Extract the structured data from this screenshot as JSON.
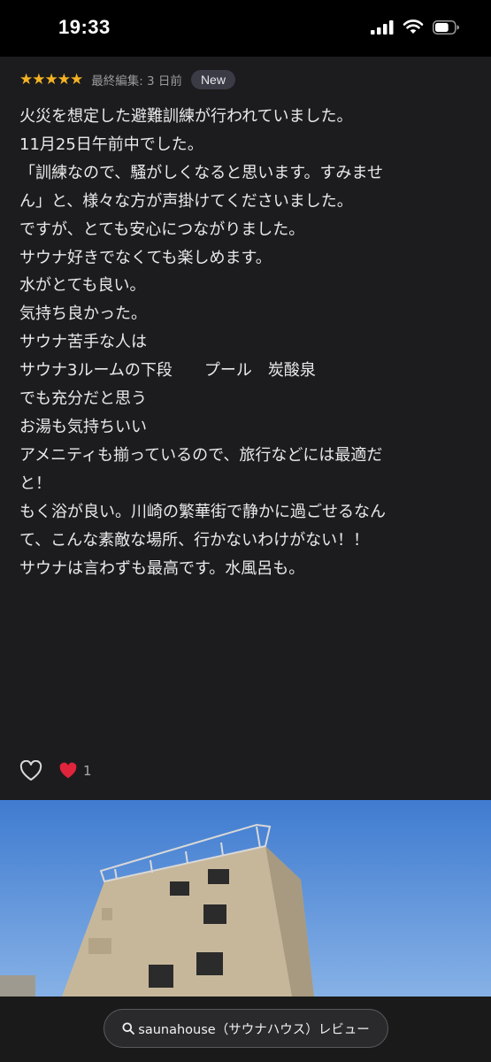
{
  "status_bar": {
    "time": "19:33",
    "battery_level": 0.7
  },
  "review": {
    "rating": 5,
    "stars": "★★★★★",
    "edited": "最終編集: 3 日前",
    "badge": "New",
    "paragraphs": [
      "火災を想定した避難訓練が行われていました。",
      "11月25日午前中でした。",
      "「訓練なので、騒がしくなると思います。すみませ",
      "ん」と、様々な方が声掛けてくださいました。",
      "ですが、とても安心につながりました。",
      "",
      "サウナ好きでなくても楽しめます。",
      "",
      "水がとても良い。",
      "気持ち良かった。",
      "",
      "サウナ苦手な人は",
      "サウナ3ルームの下段　　プール　炭酸泉",
      "でも充分だと思う",
      "お湯も気持ちいい",
      "",
      "アメニティも揃っているので、旅行などには最適だ",
      "と！",
      "",
      "もく浴が良い。川崎の繁華街で静かに過ごせるなん",
      "て、こんな素敵な場所、行かないわけがない！！",
      "",
      "サウナは言わずも最高です。水風呂も。"
    ],
    "like_count": "1",
    "heart_emoji": "❤️"
  },
  "search": {
    "label": "saunahouse（サウナハウス）レビュー"
  },
  "colors": {
    "background": "#1c1c1e",
    "star": "#f5b323",
    "sky": "#4f86d2",
    "heart": "#e0243b"
  }
}
